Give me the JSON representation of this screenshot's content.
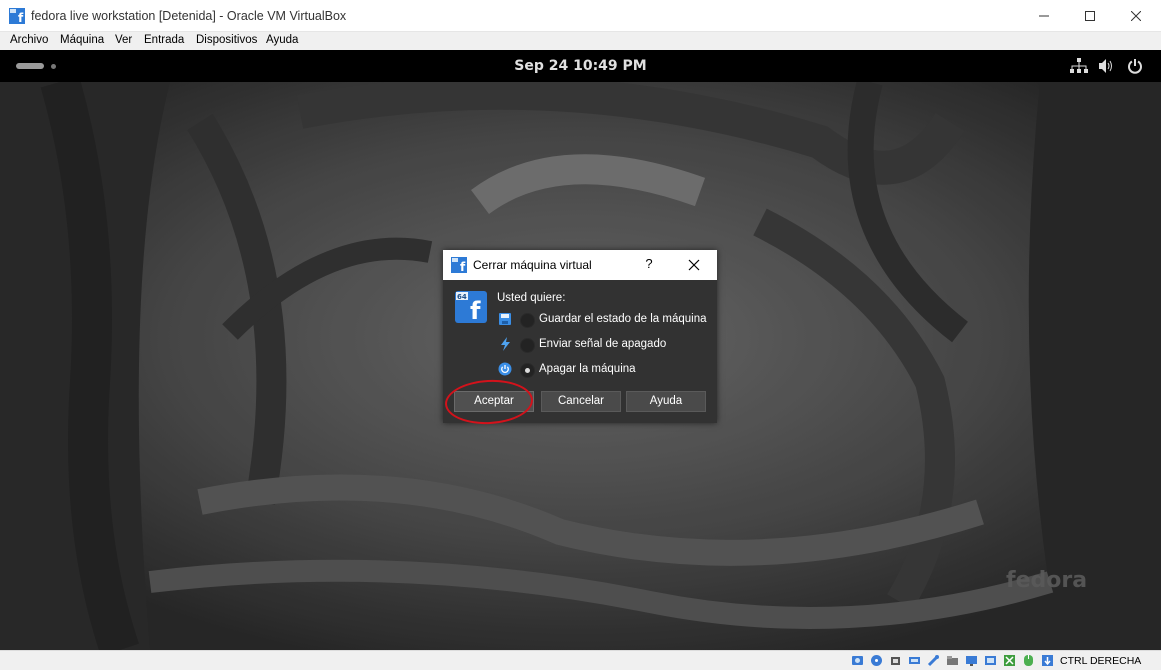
{
  "window": {
    "title": "fedora live workstation [Detenida] - Oracle VM VirtualBox"
  },
  "menu": [
    "Archivo",
    "Máquina",
    "Ver",
    "Entrada",
    "Dispositivos",
    "Ayuda"
  ],
  "guest": {
    "clock": "Sep 24  10:49 PM",
    "watermark": "fedora"
  },
  "dialog": {
    "title": "Cerrar máquina virtual",
    "help_glyph": "?",
    "prompt": "Usted quiere:",
    "options": [
      {
        "label": "Guardar el estado de la máquina",
        "icon": "save-state-icon",
        "selected": false
      },
      {
        "label": "Enviar señal de apagado",
        "icon": "acpi-shutdown-icon",
        "selected": false
      },
      {
        "label": "Apagar la máquina",
        "icon": "power-off-icon",
        "selected": true
      }
    ],
    "buttons": {
      "accept": "Aceptar",
      "cancel": "Cancelar",
      "help": "Ayuda"
    }
  },
  "status": {
    "host_key": "CTRL DERECHA"
  },
  "colors": {
    "highlight": "#d3121b",
    "dialog_bg": "#323232",
    "brand": "#2d7ad6"
  }
}
